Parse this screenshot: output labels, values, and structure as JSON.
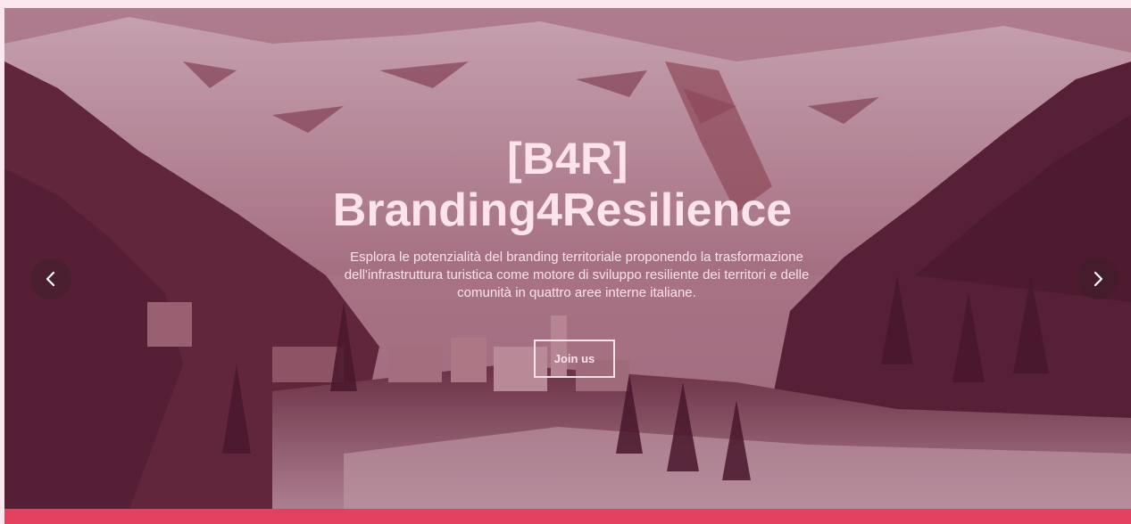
{
  "hero": {
    "title_line1": "[B4R]",
    "title_line2": "Branding4Resilience",
    "subtitle": "Esplora le potenzialità del branding territoriale proponendo la trasformazione dell'infrastruttura turistica come motore di sviluppo resiliente dei territori e delle comunità in quattro aree interne italiane.",
    "cta_label": "Join us"
  },
  "carousel": {
    "prev_icon": "chevron-left-icon",
    "next_icon": "chevron-right-icon"
  },
  "colors": {
    "page_background": "#fde7ee",
    "hero_text": "#fde3ec",
    "accent_bar": "#e4405f",
    "overlay_tint": "#6e1c3c"
  }
}
